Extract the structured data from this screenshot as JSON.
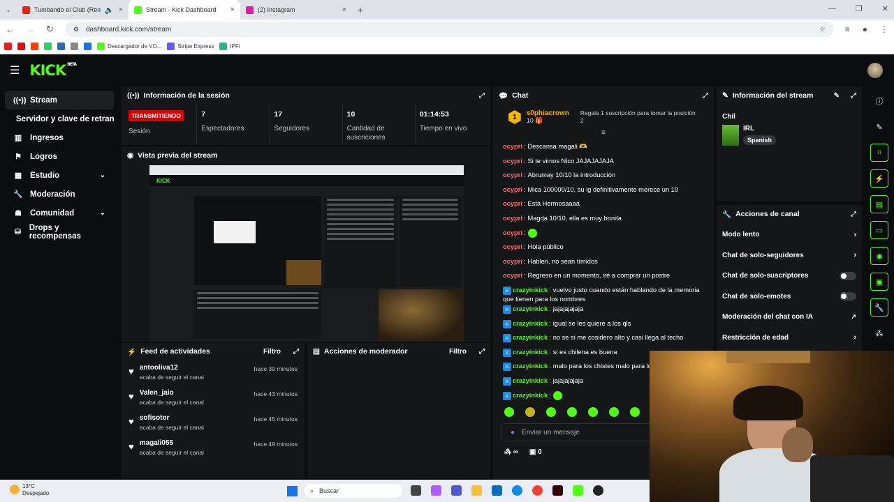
{
  "browser": {
    "tabs": [
      {
        "title": "Tumbando el Club (Remix)",
        "color": "#e62117"
      },
      {
        "title": "Stream - Kick Dashboard",
        "color": "#53fc18"
      },
      {
        "title": "(2) Instagram",
        "color": "#d6249f"
      }
    ],
    "url": "dashboard.kick.com/stream",
    "bookmarks": [
      {
        "label": "",
        "color": "#e62117"
      },
      {
        "label": "",
        "color": "#e50914"
      },
      {
        "label": "",
        "color": "#ff3d00"
      },
      {
        "label": "",
        "color": "#25d366"
      },
      {
        "label": "",
        "color": "#2b6cb0"
      },
      {
        "label": "",
        "color": "#888888"
      },
      {
        "label": "",
        "color": "#1a73e8"
      },
      {
        "label": "Descargador de VO...",
        "color": "#53fc18"
      },
      {
        "label": "Stripe Express",
        "color": "#635bff"
      },
      {
        "label": "IPFi",
        "color": "#2db37d"
      }
    ]
  },
  "header": {
    "logo": "KICK",
    "beta": "BETA"
  },
  "sidebar": {
    "items": [
      {
        "label": "Stream",
        "icon": "broadcast-icon"
      },
      {
        "label": "Servidor y clave de retransmisión",
        "icon": ""
      },
      {
        "label": "Ingresos",
        "icon": "chart-icon"
      },
      {
        "label": "Logros",
        "icon": "trophy-icon"
      },
      {
        "label": "Estudio",
        "icon": "studio-icon"
      },
      {
        "label": "Moderación",
        "icon": "wrench-icon"
      },
      {
        "label": "Comunidad",
        "icon": "community-icon"
      },
      {
        "label": "Drops y recompensas",
        "icon": "gift-icon"
      }
    ]
  },
  "session": {
    "title": "Información de la sesión",
    "badge": "TRANSMITIENDO",
    "stats": [
      {
        "value": "",
        "label": "Sesión"
      },
      {
        "value": "7",
        "label": "Espectadores"
      },
      {
        "value": "17",
        "label": "Seguidores"
      },
      {
        "value": "10",
        "label": "Cantidad de suscriciones"
      },
      {
        "value": "01:14:53",
        "label": "Tiempo en vivo"
      }
    ]
  },
  "preview": {
    "title": "Vista previa del stream"
  },
  "feed": {
    "title": "Feed de actividades",
    "filter": "Filtro",
    "items": [
      {
        "name": "antooliva12",
        "action": "acaba de seguir el canal",
        "time": "hace 39 minutos"
      },
      {
        "name": "Valen_jaio",
        "action": "acaba de seguir el canal",
        "time": "hace 43 minutos"
      },
      {
        "name": "sofisotor",
        "action": "acaba de seguir el canal",
        "time": "hace 45 minutos"
      },
      {
        "name": "magali055",
        "action": "acaba de seguir el canal",
        "time": "hace 49 minutos"
      }
    ]
  },
  "modactions": {
    "title": "Acciones de moderador",
    "filter": "Filtro"
  },
  "chat": {
    "title": "Chat",
    "top_gifter": {
      "rank": "1",
      "name": "s0phiacrown",
      "count": "10"
    },
    "gift_text": "Regala 1 suscripción para tomar la posición 2",
    "messages": [
      {
        "user": "ocypri",
        "text": "Descansa magali 🫶",
        "color": "red",
        "mod": false
      },
      {
        "user": "ocypri",
        "text": "Si te vimos Nico JAJAJAJAJA",
        "color": "red",
        "mod": false
      },
      {
        "user": "ocypri",
        "text": "Abrumay 10/10 la introducción",
        "color": "red",
        "mod": false
      },
      {
        "user": "ocypri",
        "text": "Mica 100000/10, su ig definitivamente merece un 10",
        "color": "red",
        "mod": false
      },
      {
        "user": "ocypri",
        "text": "Esta Hermosaaaa",
        "color": "red",
        "mod": false
      },
      {
        "user": "ocypri",
        "text": "Magda 10/10, ella es muy bonita",
        "color": "red",
        "mod": false
      },
      {
        "user": "ocypri",
        "text": "",
        "color": "red",
        "mod": false,
        "emote": true
      },
      {
        "user": "ocypri",
        "text": "Hola público",
        "color": "red",
        "mod": false
      },
      {
        "user": "ocypri",
        "text": "Hablen, no sean tímidos",
        "color": "red",
        "mod": false
      },
      {
        "user": "ocypri",
        "text": "Regreso en un momento, iré a comprar un postre",
        "color": "red",
        "mod": false
      },
      {
        "user": "crazyinkick",
        "text": "vuelvo justo cuando están hablando de la memoria que tienen para los nombres",
        "color": "green",
        "mod": true
      },
      {
        "user": "crazyinkick",
        "text": "jajajajajaja",
        "color": "green",
        "mod": true
      },
      {
        "user": "crazyinkick",
        "text": "igual se les quiere a los qls",
        "color": "green",
        "mod": true
      },
      {
        "user": "crazyinkick",
        "text": "no se si me cosidero alto y casi llega al techo",
        "color": "green",
        "mod": true
      },
      {
        "user": "crazyinkick",
        "text": "si es chilena es buena",
        "color": "green",
        "mod": true
      },
      {
        "user": "crazyinkick",
        "text": "malo para los chistes malo para los",
        "color": "green",
        "mod": true
      },
      {
        "user": "crazyinkick",
        "text": "jajajajajaja",
        "color": "green",
        "mod": true
      },
      {
        "user": "crazyinkick",
        "text": "",
        "color": "green",
        "mod": true,
        "emote": true
      }
    ],
    "input_placeholder": "Enviar un mensaje",
    "bottom_count": "0"
  },
  "stream_info": {
    "title": "Información del stream",
    "stream_title": "Chil",
    "category": "IRL",
    "language": "Spanish"
  },
  "channel_actions": {
    "title": "Acciones de canal",
    "items": [
      {
        "label": "Modo lento",
        "control": "chevron"
      },
      {
        "label": "Chat de solo-seguidores",
        "control": "chevron"
      },
      {
        "label": "Chat de solo-suscriptores",
        "control": "toggle"
      },
      {
        "label": "Chat de solo-emotes",
        "control": "toggle"
      },
      {
        "label": "Moderación del chat con IA",
        "control": "external"
      },
      {
        "label": "Restricción de edad",
        "control": "chevron"
      }
    ]
  },
  "taskbar": {
    "temp": "13°C",
    "weather": "Despejado",
    "search": "Buscar",
    "notif": "1"
  }
}
